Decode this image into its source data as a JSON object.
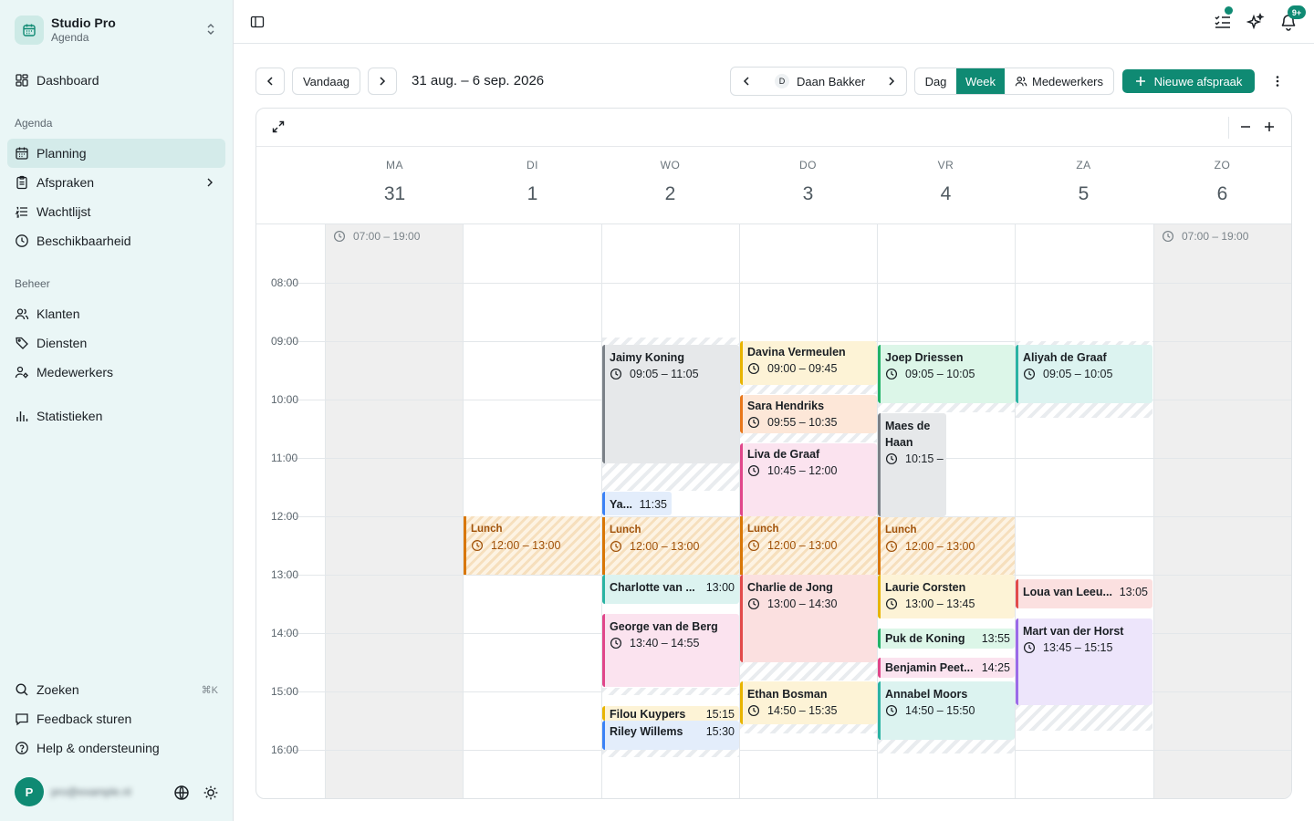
{
  "workspace": {
    "name": "Studio Pro",
    "subtitle": "Agenda"
  },
  "nav": {
    "dashboard": "Dashboard",
    "section_agenda": "Agenda",
    "planning": "Planning",
    "afspraken": "Afspraken",
    "wachtlijst": "Wachtlijst",
    "beschikbaarheid": "Beschikbaarheid",
    "section_beheer": "Beheer",
    "klanten": "Klanten",
    "diensten": "Diensten",
    "medewerkers": "Medewerkers",
    "statistieken": "Statistieken",
    "zoeken": "Zoeken",
    "zoeken_shortcut": "⌘K",
    "feedback": "Feedback sturen",
    "help": "Help & ondersteuning"
  },
  "user": {
    "initial": "P",
    "email": "pro@example.nl"
  },
  "topbar": {
    "notifications_badge": "9+"
  },
  "toolbar": {
    "today": "Vandaag",
    "range": "31 aug. – 6 sep. 2026",
    "employee_initial": "D",
    "employee": "Daan Bakker",
    "view_day": "Dag",
    "view_week": "Week",
    "view_staff": "Medewerkers",
    "new_appointment": "Nieuwe afspraak"
  },
  "colors": {
    "accent": "#0f8a73"
  },
  "days": [
    {
      "dow": "MA",
      "num": "31"
    },
    {
      "dow": "DI",
      "num": "1"
    },
    {
      "dow": "WO",
      "num": "2"
    },
    {
      "dow": "DO",
      "num": "3"
    },
    {
      "dow": "VR",
      "num": "4"
    },
    {
      "dow": "ZA",
      "num": "5"
    },
    {
      "dow": "ZO",
      "num": "6"
    }
  ],
  "hours": [
    "08:00",
    "09:00",
    "10:00",
    "11:00",
    "12:00",
    "13:00",
    "14:00",
    "15:00",
    "16:00"
  ],
  "closed_hours": "07:00 – 19:00",
  "lunch": {
    "title": "Lunch",
    "time": "12:00 – 13:00"
  },
  "events": {
    "jaimy": {
      "name": "Jaimy Koning",
      "time": "09:05 – 11:05"
    },
    "ya": {
      "name": "Ya...",
      "time": "11:35"
    },
    "charlotte": {
      "name": "Charlotte van ...",
      "time": "13:00"
    },
    "george": {
      "name": "George van de Berg",
      "time": "13:40 – 14:55"
    },
    "filou": {
      "name": "Filou Kuypers",
      "time": "15:15"
    },
    "riley": {
      "name": "Riley Willems",
      "time": "15:30"
    },
    "davina": {
      "name": "Davina Vermeulen",
      "time": "09:00 – 09:45"
    },
    "sara": {
      "name": "Sara Hendriks",
      "time": "09:55 – 10:35"
    },
    "liva": {
      "name": "Liva de Graaf",
      "time": "10:45 – 12:00"
    },
    "charlie": {
      "name": "Charlie de Jong",
      "time": "13:00 – 14:30"
    },
    "ethan": {
      "name": "Ethan Bosman",
      "time": "14:50 – 15:35"
    },
    "joep": {
      "name": "Joep Driessen",
      "time": "09:05 – 10:05"
    },
    "maes": {
      "name": "Maes de Haan",
      "time": "10:15 –"
    },
    "laurie": {
      "name": "Laurie Corsten",
      "time": "13:00 – 13:45"
    },
    "puk": {
      "name": "Puk de Koning",
      "time": "13:55"
    },
    "benjamin": {
      "name": "Benjamin Peet...",
      "time": "14:25"
    },
    "annabel": {
      "name": "Annabel Moors",
      "time": "14:50 – 15:50"
    },
    "aliyah": {
      "name": "Aliyah de Graaf",
      "time": "09:05 – 10:05"
    },
    "loua": {
      "name": "Loua van Leeu...",
      "time": "13:05"
    },
    "mart": {
      "name": "Mart van der Horst",
      "time": "13:45 – 15:15"
    }
  }
}
